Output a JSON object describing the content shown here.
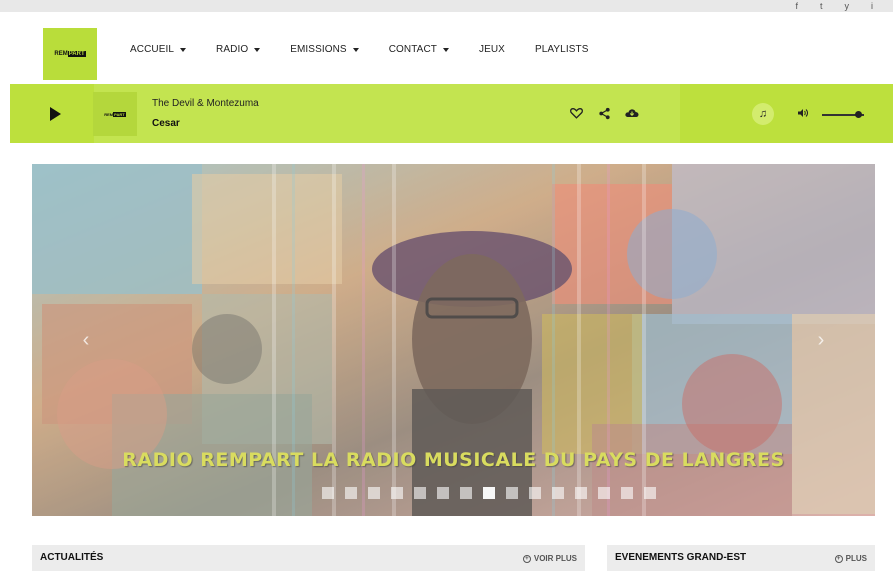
{
  "social": [
    "f",
    "t",
    "y",
    "i"
  ],
  "logo": {
    "part1": "REM",
    "part2": "PART"
  },
  "menu": [
    {
      "label": "ACCUEIL",
      "dropdown": true
    },
    {
      "label": "RADIO",
      "dropdown": true
    },
    {
      "label": "EMISSIONS",
      "dropdown": true
    },
    {
      "label": "CONTACT",
      "dropdown": true
    },
    {
      "label": "JEUX",
      "dropdown": false
    },
    {
      "label": "PLAYLISTS",
      "dropdown": false
    }
  ],
  "player": {
    "title": "The Devil & Montezuma",
    "artist": "Cesar",
    "volume_fraction": 0.85,
    "icons": [
      "play-icon",
      "heart-icon",
      "share-icon",
      "cloud-download-icon",
      "music-note-icon",
      "volume-icon"
    ]
  },
  "hero": {
    "caption": "RADIO REMPART LA RADIO MUSICALE DU PAYS DE LANGRES",
    "slide_count": 15,
    "active_slide": 7,
    "prev_label": "‹",
    "next_label": "›"
  },
  "sections": {
    "news": {
      "title": "ACTUALITÉS",
      "more": "VOIR PLUS"
    },
    "events": {
      "title": "EVENEMENTS GRAND-EST",
      "more": "PLUS"
    }
  },
  "colors": {
    "accent": "#bde03d",
    "accent_dark": "#b9dd3a",
    "section_bg": "#ececec"
  }
}
